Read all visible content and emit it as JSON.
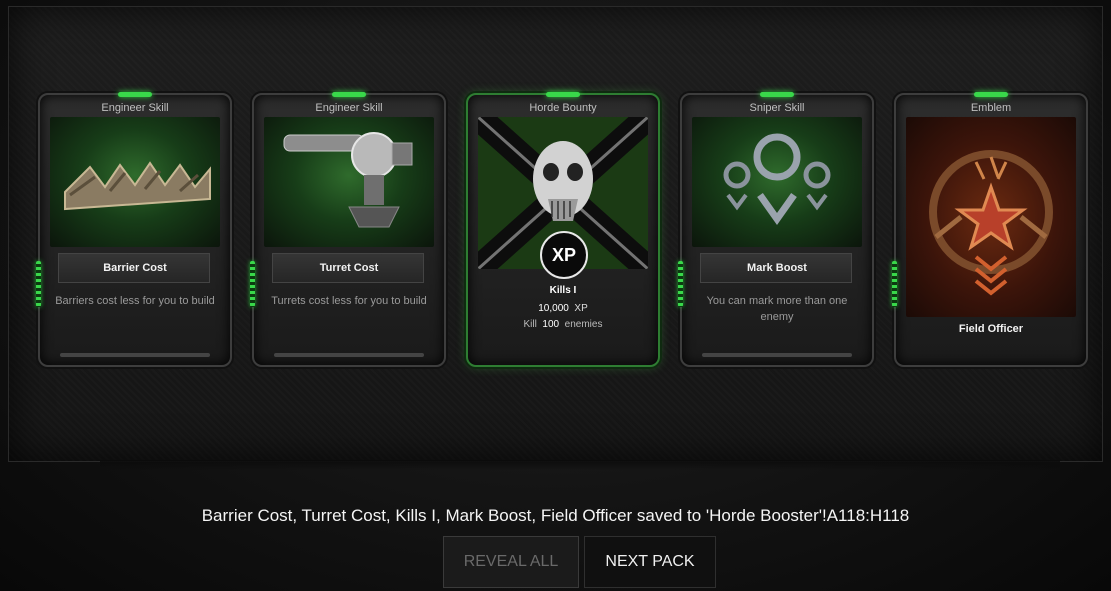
{
  "cards": [
    {
      "type": "Engineer Skill",
      "name": "Barrier Cost",
      "description": "Barriers cost less for you to build"
    },
    {
      "type": "Engineer Skill",
      "name": "Turret Cost",
      "description": "Turrets cost less for you to build"
    },
    {
      "type": "Horde Bounty",
      "name": "Kills I",
      "badge": "XP",
      "xp_value": "10,000",
      "xp_unit": "XP",
      "kill_prefix": "Kill",
      "kill_count": "100",
      "kill_suffix": "enemies"
    },
    {
      "type": "Sniper Skill",
      "name": "Mark Boost",
      "description": "You can mark more than one enemy"
    },
    {
      "type": "Emblem",
      "name": "Field Officer"
    }
  ],
  "status_message": "Barrier Cost, Turret Cost, Kills I, Mark Boost, Field Officer saved to 'Horde Booster'!A118:H118",
  "buttons": {
    "reveal_all": "REVEAL ALL",
    "next_pack": "NEXT PACK"
  },
  "colors": {
    "accent_green": "#39d84a",
    "featured_border": "#2e7d32"
  },
  "icons": [
    "barrier-icon",
    "turret-icon",
    "skull-icon",
    "xp-badge-icon",
    "mark-targets-icon",
    "star-emblem-icon"
  ]
}
